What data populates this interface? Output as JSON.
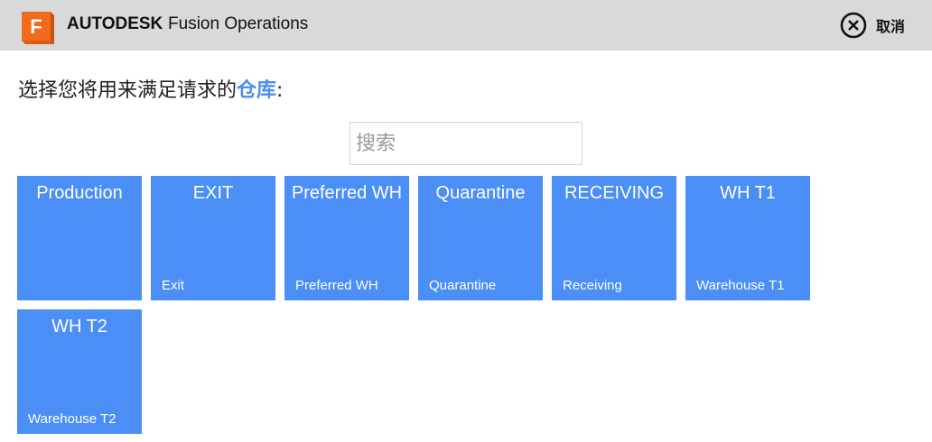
{
  "header": {
    "brand_bold": "AUTODESK",
    "brand_light": "Fusion Operations",
    "logo_icon": "fusion-logo-icon",
    "cancel_label": "取消",
    "cancel_icon": "close-circle-icon"
  },
  "prompt": {
    "before": "选择您将用来满足请求的",
    "highlight": "仓库",
    "after": ":"
  },
  "search": {
    "placeholder": "搜索",
    "value": ""
  },
  "warehouses": [
    {
      "title": "Production",
      "subtitle": ""
    },
    {
      "title": "EXIT",
      "subtitle": "Exit"
    },
    {
      "title": "Preferred WH",
      "subtitle": "Preferred WH"
    },
    {
      "title": "Quarantine",
      "subtitle": "Quarantine"
    },
    {
      "title": "RECEIVING",
      "subtitle": "Receiving"
    },
    {
      "title": "WH T1",
      "subtitle": "Warehouse T1"
    },
    {
      "title": "WH T2",
      "subtitle": "Warehouse T2"
    }
  ],
  "colors": {
    "tile": "#4a8ef6",
    "highlight": "#4a8ef0",
    "topbar": "#d9d9d9",
    "logo": "#f26a1b"
  }
}
